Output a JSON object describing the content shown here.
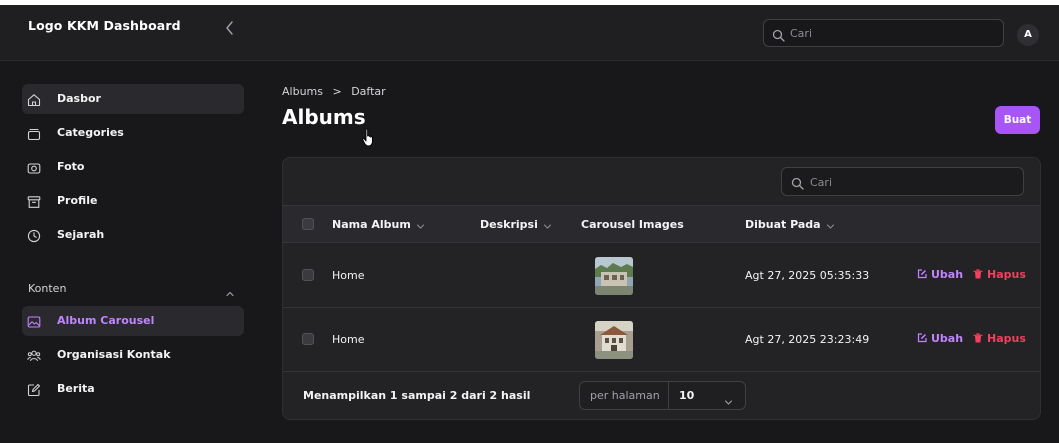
{
  "brand": "Logo KKM Dashboard",
  "search": {
    "placeholder": "Cari"
  },
  "user": {
    "initial": "A"
  },
  "sidebar": {
    "items": [
      {
        "label": "Dasbor",
        "icon": "home-icon"
      },
      {
        "label": "Categories",
        "icon": "box-icon"
      },
      {
        "label": "Foto",
        "icon": "camera-icon"
      },
      {
        "label": "Profile",
        "icon": "archive-icon"
      },
      {
        "label": "Sejarah",
        "icon": "clock-icon"
      }
    ],
    "group": {
      "label": "Konten",
      "items": [
        {
          "label": "Album Carousel",
          "icon": "image-icon"
        },
        {
          "label": "Organisasi Kontak",
          "icon": "users-icon"
        },
        {
          "label": "Berita",
          "icon": "edit-icon"
        }
      ]
    }
  },
  "breadcrumb": {
    "first": "Albums",
    "separator": ">",
    "second": "Daftar"
  },
  "page": {
    "title": "Albums",
    "create_label": "Buat"
  },
  "table": {
    "search_placeholder": "Cari",
    "columns": [
      "Nama Album",
      "Deskripsi",
      "Carousel Images",
      "Dibuat Pada"
    ],
    "rows": [
      {
        "name": "Home",
        "created": "Agt 27, 2025 05:35:33",
        "edit": "Ubah",
        "delete": "Hapus"
      },
      {
        "name": "Home",
        "created": "Agt 27, 2025 23:23:49",
        "edit": "Ubah",
        "delete": "Hapus"
      }
    ],
    "summary": "Menampilkan 1 sampai 2 dari 2 hasil",
    "per_page_label": "per halaman",
    "per_page_value": "10"
  },
  "colors": {
    "accent": "#a855f7",
    "danger": "#f43f5e",
    "background": "#18181b"
  }
}
